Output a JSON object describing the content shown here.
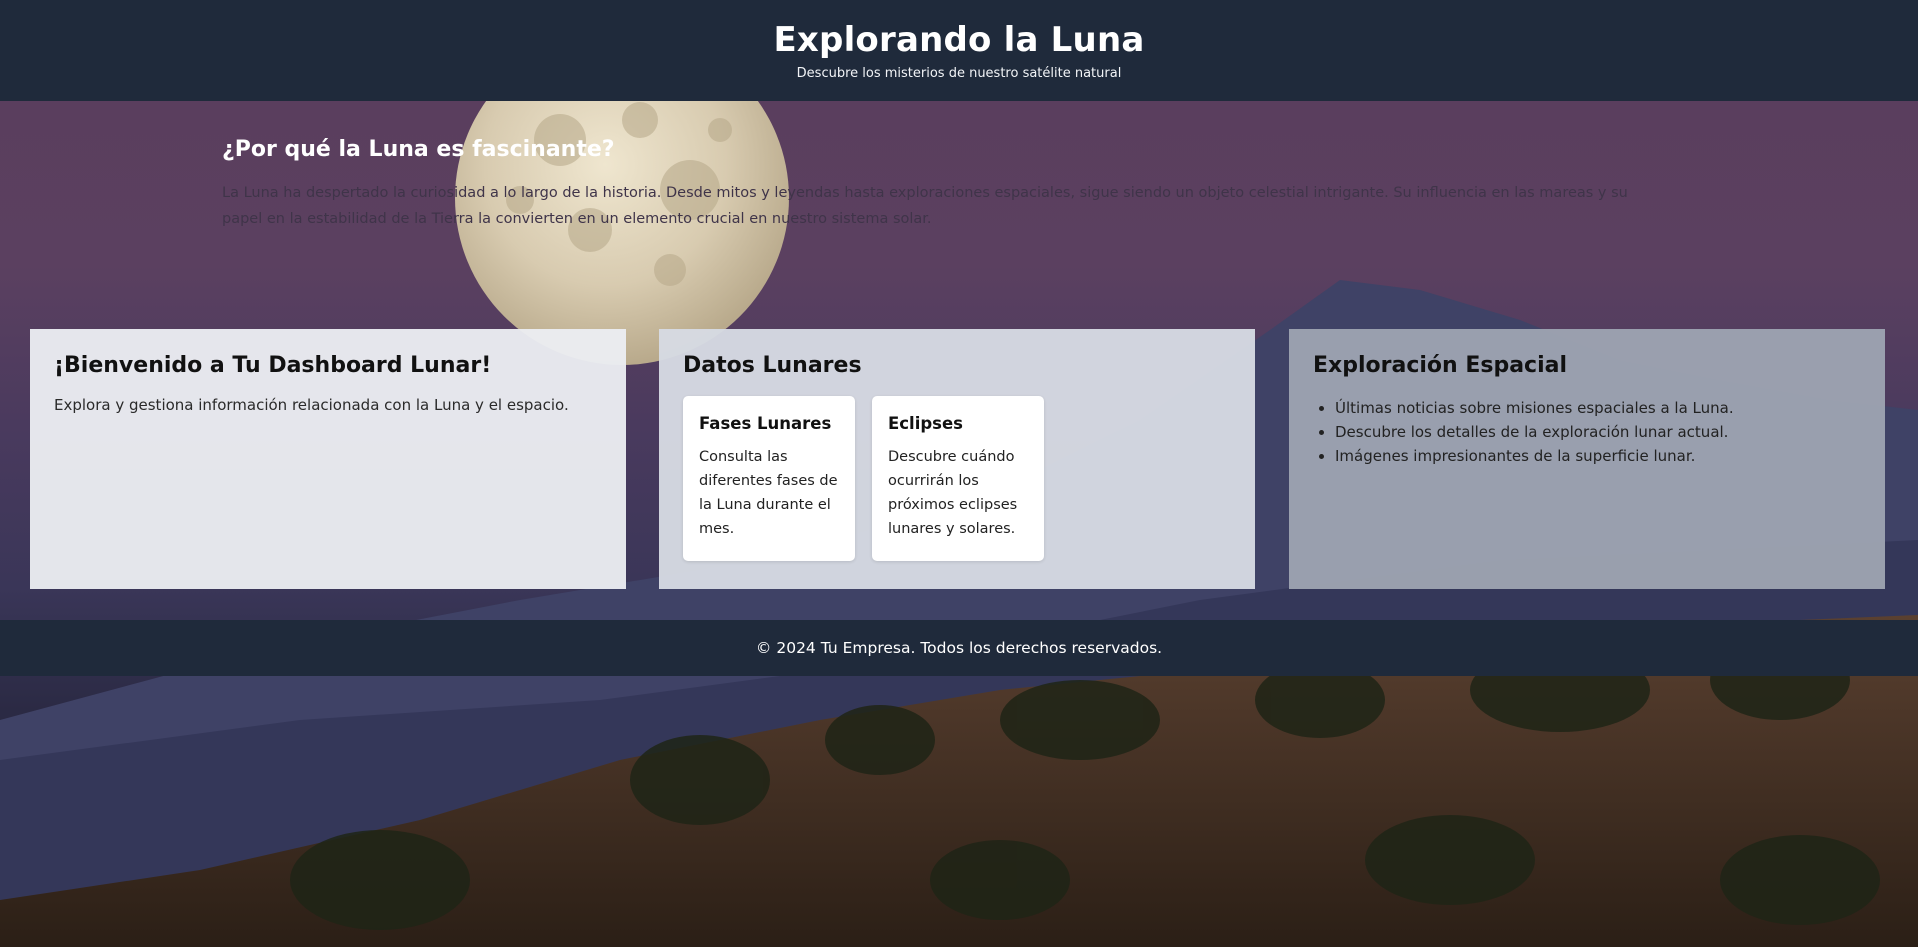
{
  "header": {
    "title": "Explorando la Luna",
    "subtitle": "Descubre los misterios de nuestro satélite natural"
  },
  "intro": {
    "heading": "¿Por qué la Luna es fascinante?",
    "text": "La Luna ha despertado la curiosidad a lo largo de la historia. Desde mitos y leyendas hasta exploraciones espaciales, sigue siendo un objeto celestial intrigante. Su influencia en las mareas y su papel en la estabilidad de la Tierra la convierten en un elemento crucial en nuestro sistema solar."
  },
  "cards": {
    "welcome": {
      "title": "¡Bienvenido a Tu Dashboard Lunar!",
      "text": "Explora y gestiona información relacionada con la Luna y el espacio."
    },
    "data": {
      "title": "Datos Lunares",
      "items": [
        {
          "title": "Fases Lunares",
          "text": "Consulta las diferentes fases de la Luna durante el mes."
        },
        {
          "title": "Eclipses",
          "text": "Descubre cuándo ocurrirán los próximos eclipses lunares y solares."
        }
      ]
    },
    "exploration": {
      "title": "Exploración Espacial",
      "items": [
        "Últimas noticias sobre misiones espaciales a la Luna.",
        "Descubre los detalles de la exploración lunar actual.",
        "Imágenes impresionantes de la superficie lunar."
      ]
    }
  },
  "footer": {
    "text": "© 2024 Tu Empresa. Todos los derechos reservados."
  },
  "colors": {
    "header_bg": "#1f2a3b",
    "sky": "#5a3d5c",
    "moon": "#d9cfb6"
  }
}
